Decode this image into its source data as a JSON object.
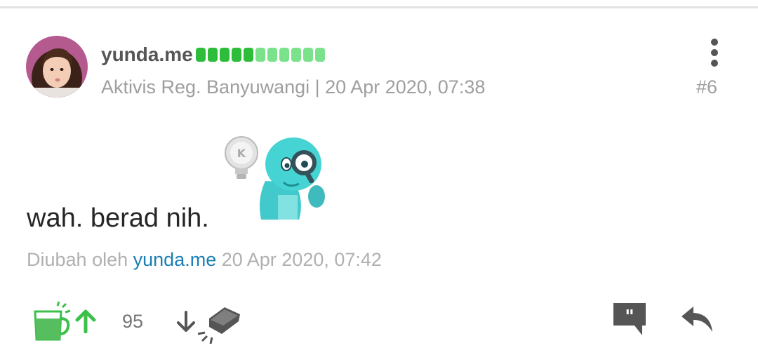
{
  "post": {
    "username": "yunda.me",
    "meta": "Aktivis Reg. Banyuwangi | 20 Apr 2020, 07:38",
    "post_number": "#6",
    "text": "wah. berad nih.",
    "edited_prefix": "Diubah oleh",
    "edited_by": "yunda.me",
    "edited_time": "20 Apr 2020, 07:42"
  },
  "reputation": {
    "dots_total": 11,
    "dots_dark": 5,
    "color_dark": "#2dbd3a",
    "color_light": "#7ae28a"
  },
  "actions": {
    "vote_count": "95",
    "icons": [
      "more-vert-icon",
      "cendol-cup-icon",
      "arrow-up-icon",
      "arrow-down-icon",
      "bata-brick-icon",
      "quote-icon",
      "reply-icon"
    ]
  },
  "colors": {
    "accent_green": "#3cc04a",
    "link_blue": "#1b7fb3",
    "icon_gray": "#555555"
  }
}
